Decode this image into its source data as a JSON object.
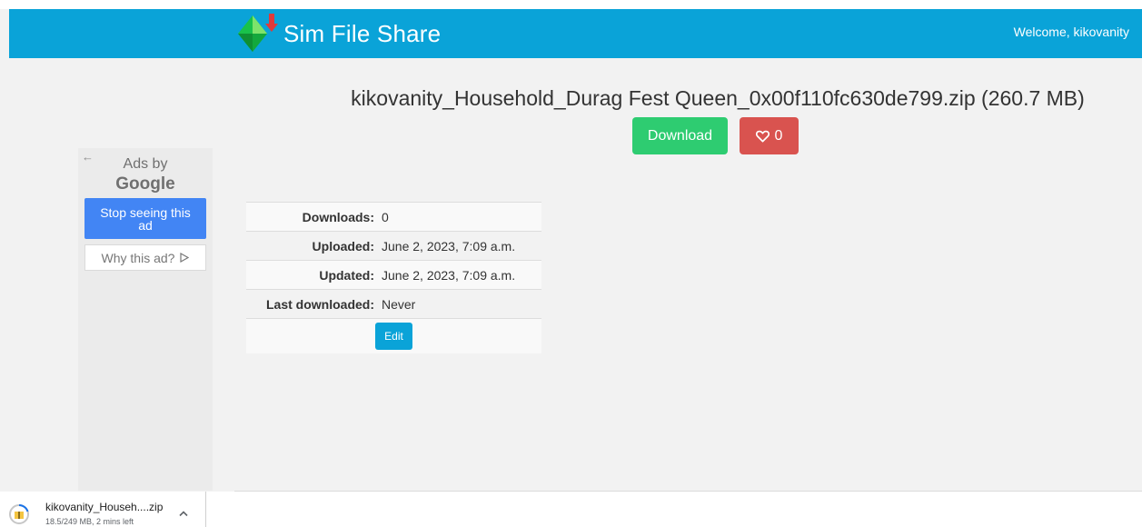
{
  "navbar": {
    "brand": "Sim File Share",
    "welcome": "Welcome, kikovanity",
    "background": "#0aa3d8"
  },
  "file": {
    "title": "kikovanity_Household_Durag Fest Queen_0x00f110fc630de799.zip (260.7 MB)",
    "download_label": "Download",
    "like_count": "0"
  },
  "ad": {
    "back_arrow": "←",
    "ads_by": "Ads by",
    "google": "Google",
    "stop_label": "Stop seeing this ad",
    "why_label": "Why this ad?"
  },
  "details": {
    "rows": [
      {
        "label": "Downloads:",
        "value": "0"
      },
      {
        "label": "Uploaded:",
        "value": "June 2, 2023, 7:09 a.m."
      },
      {
        "label": "Updated:",
        "value": "June 2, 2023, 7:09 a.m."
      },
      {
        "label": "Last downloaded:",
        "value": "Never"
      }
    ],
    "edit_label": "Edit"
  },
  "download_bar": {
    "filename": "kikovanity_Househ....zip",
    "status": "18.5/249 MB, 2 mins left"
  },
  "colors": {
    "download_button": "#2ecc71",
    "like_button": "#d9534f",
    "edit_button": "#0aa3d8",
    "stop_ad_button": "#4285f4"
  },
  "icons": {
    "logo": "plumbob-download-logo-icon",
    "like": "heart-icon",
    "adchoices": "adchoices-icon",
    "zip": "zip-file-icon",
    "chevron": "chevron-up-icon"
  }
}
